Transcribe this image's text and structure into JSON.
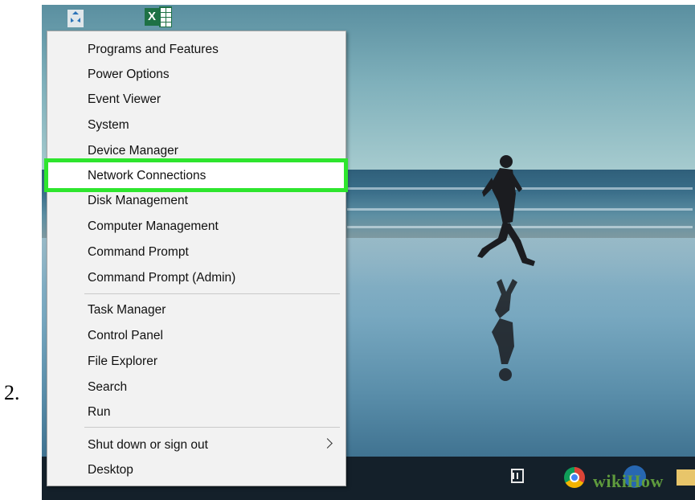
{
  "step_number": "2.",
  "desktop": {
    "icons": [
      "recycle-bin-icon",
      "excel-icon"
    ],
    "excel_letter": "X"
  },
  "context_menu": {
    "groups": [
      [
        "Programs and Features",
        "Power Options",
        "Event Viewer",
        "System",
        "Device Manager",
        "Network Connections",
        "Disk Management",
        "Computer Management",
        "Command Prompt",
        "Command Prompt (Admin)"
      ],
      [
        "Task Manager",
        "Control Panel",
        "File Explorer",
        "Search",
        "Run"
      ],
      [
        "Shut down or sign out",
        "Desktop"
      ]
    ],
    "highlighted_item": "Device Manager",
    "highlight_color": "#2ee52e",
    "submenu_item": "Shut down or sign out"
  },
  "taskbar": {
    "icons": [
      "task-view-icon",
      "chrome-icon",
      "app-icon",
      "folder-icon"
    ]
  },
  "watermark": "wikiHow"
}
